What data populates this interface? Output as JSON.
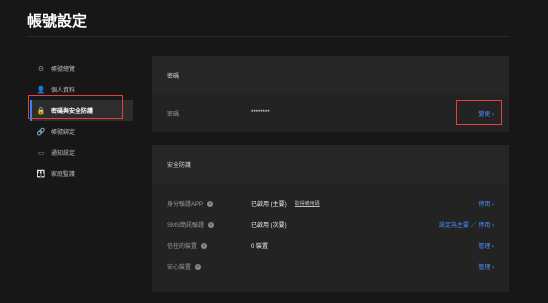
{
  "page": {
    "title": "帳號設定"
  },
  "sidebar": {
    "items": [
      {
        "label": "帳號總覽",
        "icon": "gear-icon"
      },
      {
        "label": "個人資料",
        "icon": "user-icon"
      },
      {
        "label": "密碼與安全防護",
        "icon": "lock-icon"
      },
      {
        "label": "帳號綁定",
        "icon": "link-icon"
      },
      {
        "label": "通知設定",
        "icon": "message-icon"
      },
      {
        "label": "家庭監護",
        "icon": "family-icon"
      }
    ]
  },
  "password_card": {
    "title": "密碼",
    "label": "密碼",
    "value": "********",
    "action": "變更 ›"
  },
  "security_card": {
    "title": "安全防護",
    "rows": [
      {
        "label": "身分驗證APP",
        "value": "已啟用 (主要)",
        "extra": "取得備用碼",
        "action": "停用 ›"
      },
      {
        "label": "SMS簡訊驗證",
        "value": "已啟用 (次要)",
        "action": "設定為主要 ／ 停用 ›"
      },
      {
        "label": "信任的裝置",
        "value": "0 裝置",
        "action": "管理 ›"
      },
      {
        "label": "安心裝置",
        "value": "",
        "action": "管理 ›"
      }
    ]
  },
  "colors": {
    "accent": "#4a90ff",
    "highlight": "#e2403a",
    "background": "#171717"
  }
}
